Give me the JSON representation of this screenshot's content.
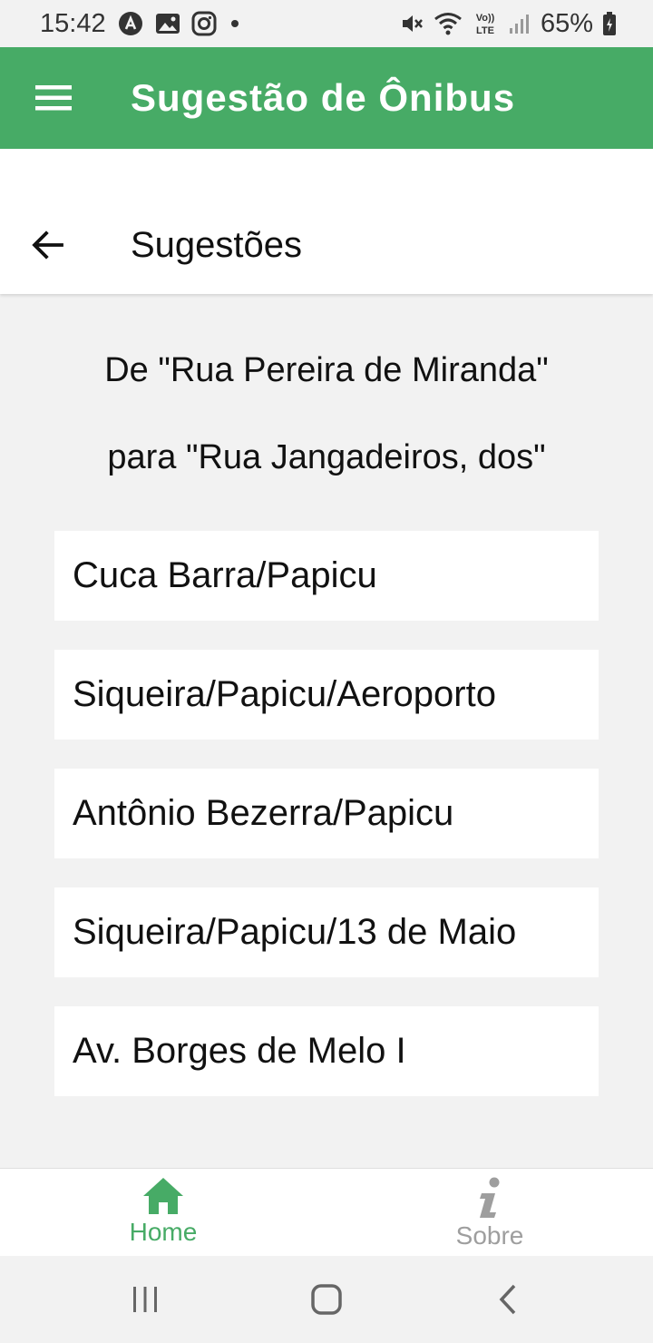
{
  "status_bar": {
    "time": "15:42",
    "battery_percent": "65%",
    "lte_label": "LTE",
    "volte_label": "Vo))",
    "notification_icons": [
      "assistant-icon",
      "image-icon",
      "instagram-icon",
      "dot-icon"
    ],
    "system_icons": [
      "mute-icon",
      "wifi-icon",
      "lte-icon",
      "signal-icon",
      "battery-charging-icon"
    ]
  },
  "app_bar": {
    "title": "Sugestão de Ônibus",
    "color": "#47ab66"
  },
  "sub_header": {
    "title": "Sugestões"
  },
  "route": {
    "from_line": "De \"Rua Pereira de Miranda\"",
    "to_line": "para \"Rua Jangadeiros, dos\""
  },
  "suggestions": [
    {
      "label": "Cuca Barra/Papicu"
    },
    {
      "label": "Siqueira/Papicu/Aeroporto"
    },
    {
      "label": "Antônio Bezerra/Papicu"
    },
    {
      "label": "Siqueira/Papicu/13 de Maio"
    },
    {
      "label": "Av. Borges de Melo I"
    }
  ],
  "bottom_nav": {
    "items": [
      {
        "label": "Home",
        "icon": "home-icon",
        "active": true
      },
      {
        "label": "Sobre",
        "icon": "info-icon",
        "active": false
      }
    ],
    "active_color": "#47ab66",
    "inactive_color": "#9e9e9e"
  },
  "system_nav": {
    "buttons": [
      "recent-apps-icon",
      "home-button-icon",
      "back-nav-icon"
    ]
  }
}
